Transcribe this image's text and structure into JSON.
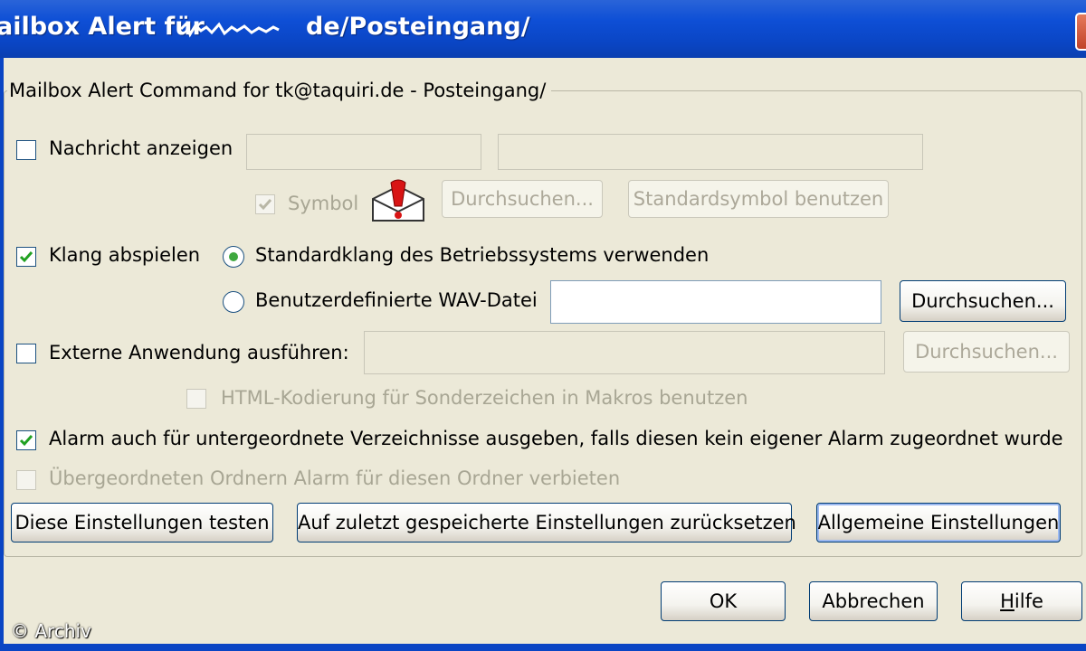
{
  "window": {
    "title": "ailbox Alert für",
    "title_suffix": "de/Posteingang/"
  },
  "group": {
    "legend": "Mailbox Alert Command for tk@taquiri.de - Posteingang/"
  },
  "show_message": {
    "label": "Nachricht anzeigen",
    "checked": false,
    "field1_value": "",
    "field2_value": ""
  },
  "symbol": {
    "label": "Symbol",
    "checked": true,
    "browse_label": "Durchsuchen...",
    "default_label": "Standardsymbol benutzen",
    "icon": "mail-alert-icon"
  },
  "sound": {
    "label": "Klang abspielen",
    "checked": true,
    "option_system": "Standardklang des Betriebssystems verwenden",
    "option_custom": "Benutzerdefinierte WAV-Datei",
    "selected": "system",
    "wav_value": "",
    "browse_label": "Durchsuchen..."
  },
  "external": {
    "label": "Externe Anwendung ausführen:",
    "checked": false,
    "value": "",
    "browse_label": "Durchsuchen..."
  },
  "html_encoding": {
    "label": "HTML-Kodierung für Sonderzeichen in Makros benutzen",
    "checked": false
  },
  "subfolders": {
    "label": "Alarm auch für untergeordnete Verzeichnisse ausgeben, falls diesen kein eigener Alarm zugeordnet wurde",
    "checked": true
  },
  "parent_forbid": {
    "label": "Übergeordneten Ordnern Alarm für diesen Ordner verbieten",
    "checked": false
  },
  "actions": {
    "test_label": "Diese Einstellungen testen",
    "reset_label": "Auf zuletzt gespeicherte Einstellungen zurücksetzen",
    "general_label": "Allgemeine Einstellungen"
  },
  "footer": {
    "ok_label": "OK",
    "cancel_label": "Abbrechen",
    "help_label": "Hilfe"
  },
  "watermark": "© Archiv",
  "colors": {
    "titlebar": "#0a45c4",
    "face": "#ece9d8",
    "check": "#21a121",
    "radio_dot": "#3fa83f",
    "disabled_text": "#a8a694"
  }
}
